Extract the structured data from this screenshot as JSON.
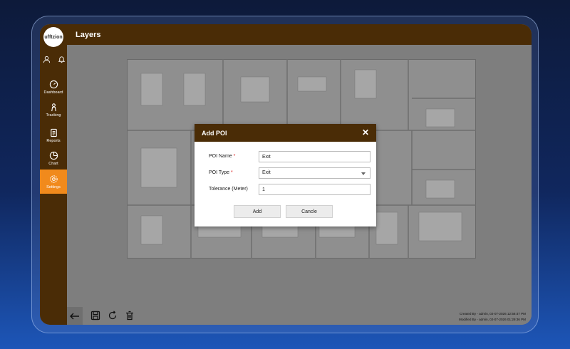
{
  "app": {
    "logo_text": "ufftzion",
    "page_title": "Layers"
  },
  "sidebar": {
    "items": [
      {
        "label": "Dashboard",
        "icon": "gauge-icon"
      },
      {
        "label": "Tracking",
        "icon": "tracking-icon"
      },
      {
        "label": "Reports",
        "icon": "reports-icon"
      },
      {
        "label": "Chart",
        "icon": "chart-icon"
      },
      {
        "label": "Settings",
        "icon": "gear-icon",
        "active": true
      }
    ]
  },
  "map_controls": {
    "zoom_in": "+",
    "zoom_out": "−"
  },
  "modal": {
    "title": "Add POI",
    "close": "✕",
    "fields": {
      "poi_name": {
        "label": "POI Name",
        "required": "*",
        "value": "Exit"
      },
      "poi_type": {
        "label": "POI Type",
        "required": "*",
        "value": "Exit"
      },
      "tolerance": {
        "label": "Tolerance (Meter)",
        "value": "1"
      }
    },
    "add_label": "Add",
    "cancel_label": "Cancle"
  },
  "footer": {
    "created_by": "Created By - admin, 02-07-2026 12:56:47 PM",
    "modified_by": "Modified By - admin, 02-07-2026 01:29:36 PM"
  },
  "colors": {
    "brand_brown": "#4a2c06",
    "active_orange": "#f18a1c"
  }
}
